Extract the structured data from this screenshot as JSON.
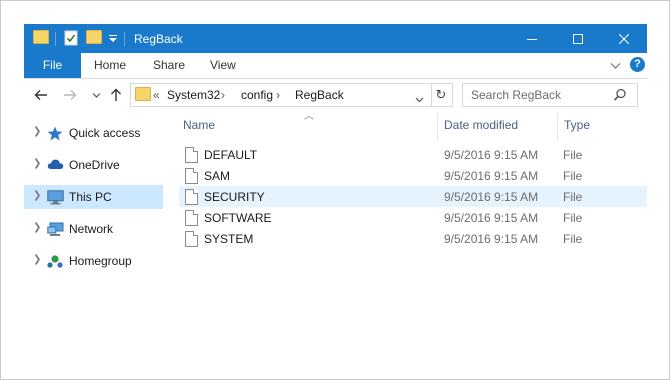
{
  "window": {
    "title": "RegBack",
    "accent_color": "#1979ca"
  },
  "ribbon": {
    "tabs": [
      {
        "label": "File"
      },
      {
        "label": "Home"
      },
      {
        "label": "Share"
      },
      {
        "label": "View"
      }
    ]
  },
  "address": {
    "overflow": "«",
    "crumbs": [
      "System32",
      "config",
      "RegBack"
    ]
  },
  "search": {
    "placeholder": "Search RegBack"
  },
  "nav": {
    "items": [
      {
        "label": "Quick access",
        "icon": "star-icon"
      },
      {
        "label": "OneDrive",
        "icon": "cloud-icon"
      },
      {
        "label": "This PC",
        "icon": "computer-icon",
        "selected": true
      },
      {
        "label": "Network",
        "icon": "network-icon"
      },
      {
        "label": "Homegroup",
        "icon": "homegroup-icon"
      }
    ]
  },
  "files": {
    "columns": [
      "Name",
      "Date modified",
      "Type"
    ],
    "rows": [
      {
        "name": "DEFAULT",
        "date": "9/5/2016 9:15 AM",
        "type": "File"
      },
      {
        "name": "SAM",
        "date": "9/5/2016 9:15 AM",
        "type": "File"
      },
      {
        "name": "SECURITY",
        "date": "9/5/2016 9:15 AM",
        "type": "File",
        "selected": true
      },
      {
        "name": "SOFTWARE",
        "date": "9/5/2016 9:15 AM",
        "type": "File"
      },
      {
        "name": "SYSTEM",
        "date": "9/5/2016 9:15 AM",
        "type": "File"
      }
    ]
  }
}
